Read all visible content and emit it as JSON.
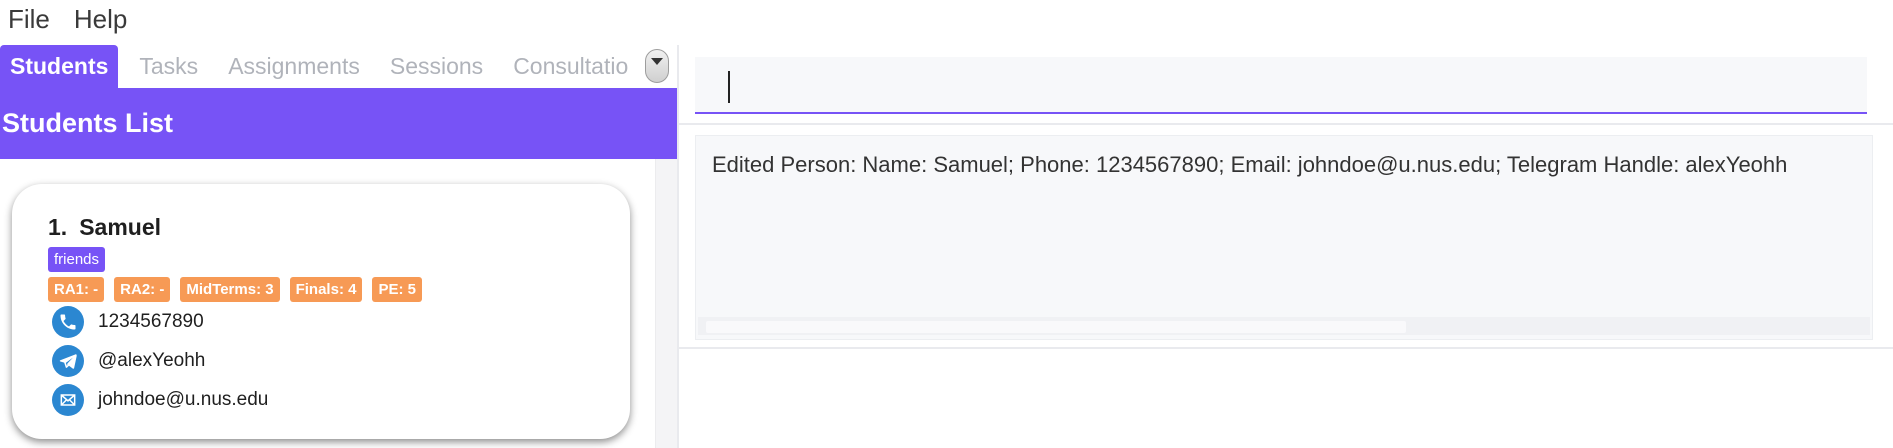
{
  "menu": {
    "items": [
      {
        "label": "File"
      },
      {
        "label": "Help"
      }
    ]
  },
  "tabs": [
    {
      "label": "Students",
      "active": true
    },
    {
      "label": "Tasks",
      "active": false
    },
    {
      "label": "Assignments",
      "active": false
    },
    {
      "label": "Sessions",
      "active": false
    },
    {
      "label": "Consultatio",
      "active": false
    }
  ],
  "students_panel": {
    "title": "Students List",
    "students": [
      {
        "index": "1.",
        "name": "Samuel",
        "tags": [
          "friends"
        ],
        "grades": [
          "RA1: -",
          "RA2: -",
          "MidTerms: 3",
          "Finals: 4",
          "PE: 5"
        ],
        "phone": "1234567890",
        "telegram": "@alexYeohh",
        "email": "johndoe@u.nus.edu",
        "phone_icon": "phone-icon",
        "telegram_icon": "telegram-icon",
        "email_icon": "email-icon"
      }
    ]
  },
  "command_box": {
    "value": "",
    "placeholder": ""
  },
  "result_display": {
    "text": "Edited Person: Name: Samuel; Phone: 1234567890; Email: johndoe@u.nus.edu; Telegram Handle: alexYeohh"
  },
  "colors": {
    "accent": "#7753f6",
    "grade_tag": "#f79a55",
    "icon_bg": "#2b87d1"
  }
}
